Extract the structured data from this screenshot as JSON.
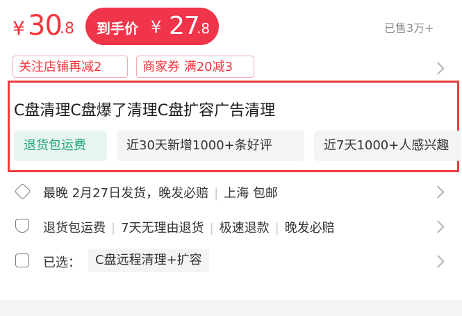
{
  "price": {
    "currency": "¥",
    "integer": "30",
    "decimal": ".8"
  },
  "final_price": {
    "label": "到手价",
    "currency": "¥",
    "integer": "27",
    "decimal": ".8"
  },
  "sold": "已售3万+",
  "coupons": [
    {
      "text": "关注店铺再减2"
    },
    {
      "text": "商家券 满20减3"
    }
  ],
  "product": {
    "title": "C盘清理C盘爆了清理C盘扩容广告清理",
    "tags": [
      "退货包运费",
      "近30天新增1000+条好评",
      "近7天1000+人感兴趣"
    ]
  },
  "shipping": {
    "items": [
      "最晚 2月27日发货，晚发必赔",
      "上海 包邮"
    ]
  },
  "guarantee": {
    "items": [
      "退货包运费",
      "7天无理由退货",
      "极速退款",
      "晚发必赔"
    ]
  },
  "selection": {
    "label": "已选：",
    "value": "C盘远程清理+扩容"
  },
  "colors": {
    "accent": "#f2353c",
    "highlight_border": "#ee3b3b",
    "green_tag": "#21a87a"
  }
}
